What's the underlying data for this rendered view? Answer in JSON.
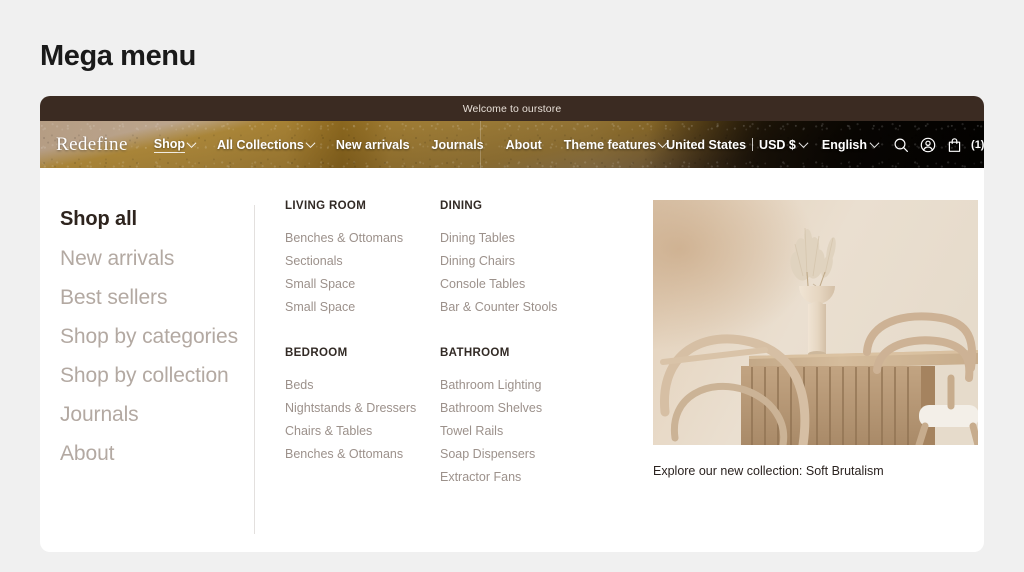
{
  "page": {
    "title": "Mega menu",
    "background_color": "#f0f0f0"
  },
  "announcement": {
    "text": "Welcome to ourstore",
    "background_color": "#3b2b22"
  },
  "navbar": {
    "brand": "Redefine",
    "links": [
      {
        "label": "Shop",
        "has_chevron": true,
        "active": true
      },
      {
        "label": "All Collections",
        "has_chevron": true,
        "active": false
      },
      {
        "label": "New arrivals",
        "has_chevron": false,
        "active": false
      },
      {
        "label": "Journals",
        "has_chevron": false,
        "active": false
      },
      {
        "label": "About",
        "has_chevron": false,
        "active": false
      },
      {
        "label": "Theme features",
        "has_chevron": true,
        "active": false
      }
    ],
    "country_selector": "United States",
    "currency_selector": "USD $",
    "language_selector": "English",
    "icons": [
      {
        "name": "search-icon"
      },
      {
        "name": "account-icon"
      },
      {
        "name": "shopping-bag-icon"
      }
    ],
    "cart_count": "(1)"
  },
  "mega_menu": {
    "primary_links": [
      {
        "label": "Shop all",
        "current": true
      },
      {
        "label": "New arrivals",
        "current": false
      },
      {
        "label": "Best sellers",
        "current": false
      },
      {
        "label": "Shop by categories",
        "current": false
      },
      {
        "label": "Shop by collection",
        "current": false
      },
      {
        "label": "Journals",
        "current": false
      },
      {
        "label": "About",
        "current": false
      }
    ],
    "columns": [
      {
        "heading": "LIVING ROOM",
        "links": [
          "Benches & Ottomans",
          "Sectionals",
          "Small Space",
          "Small Space"
        ]
      },
      {
        "heading": "DINING",
        "links": [
          "Dining Tables",
          "Dining Chairs",
          "Console Tables",
          "Bar & Counter Stools"
        ]
      },
      {
        "heading": "BEDROOM",
        "links": [
          "Beds",
          "Nightstands & Dressers",
          "Chairs & Tables",
          "Benches & Ottomans"
        ]
      },
      {
        "heading": "BATHROOM",
        "links": [
          "Bathroom Lighting",
          "Bathroom Shelves",
          "Towel Rails",
          "Soap Dispensers",
          "Extractor Fans"
        ]
      }
    ],
    "promo": {
      "image_alt": "beige interior with slatted wood console table, vase with pampas grass and bentwood chairs",
      "caption": "Explore our new collection: Soft Brutalism"
    }
  }
}
